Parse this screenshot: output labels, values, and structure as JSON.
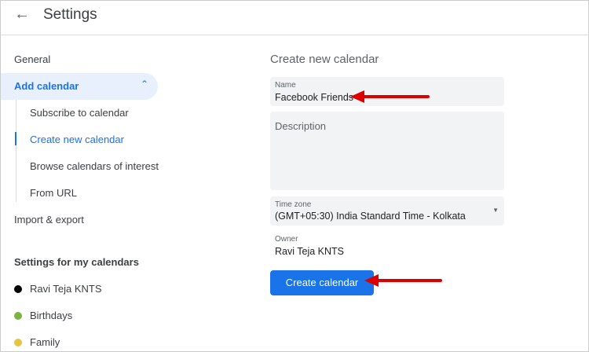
{
  "header": {
    "title": "Settings"
  },
  "sidebar": {
    "general": "General",
    "add_calendar": "Add calendar",
    "sub_items": [
      "Subscribe to calendar",
      "Create new calendar",
      "Browse calendars of interest",
      "From URL"
    ],
    "import_export": "Import & export",
    "my_calendars_heading": "Settings for my calendars",
    "calendars": [
      {
        "name": "Ravi Teja KNTS",
        "color": "#000000"
      },
      {
        "name": "Birthdays",
        "color": "#7cb342"
      },
      {
        "name": "Family",
        "color": "#e4c441"
      }
    ]
  },
  "form": {
    "heading": "Create new calendar",
    "name_label": "Name",
    "name_value": "Facebook Friends",
    "description_placeholder": "Description",
    "timezone_label": "Time zone",
    "timezone_value": "(GMT+05:30) India Standard Time - Kolkata",
    "owner_label": "Owner",
    "owner_value": "Ravi Teja KNTS",
    "create_button": "Create calendar"
  }
}
